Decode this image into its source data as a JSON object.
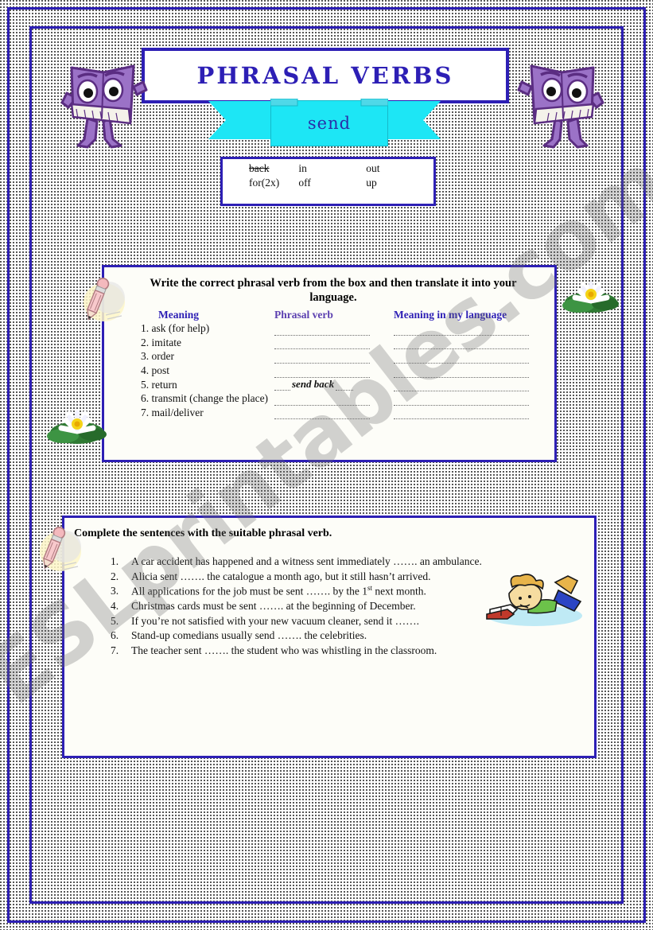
{
  "page": {
    "title": "PHRASAL VERBS",
    "verb": "send",
    "watermark": "ESLprintables.com",
    "border_color": "#2d1fb5",
    "accent_color": "#1de6f5"
  },
  "word_bank": {
    "rows": [
      {
        "c1": "back",
        "c1_struck": true,
        "c2": "in",
        "c3": "out"
      },
      {
        "c1": "for(2x)",
        "c1_struck": false,
        "c2": "off",
        "c3": "up"
      }
    ]
  },
  "exercise1": {
    "instruction": "Write the correct phrasal verb from the box and then translate it into your language.",
    "headers": {
      "meaning": "Meaning",
      "phrasal_verb": "Phrasal verb",
      "translation": "Meaning in my language"
    },
    "rows": [
      {
        "num": "1.",
        "meaning": "ask (for help)",
        "answer": ""
      },
      {
        "num": "2.",
        "meaning": "imitate",
        "answer": ""
      },
      {
        "num": "3.",
        "meaning": "order",
        "answer": ""
      },
      {
        "num": "4.",
        "meaning": "post",
        "answer": ""
      },
      {
        "num": "5.",
        "meaning": "return",
        "answer": "send back"
      },
      {
        "num": "6.",
        "meaning": "transmit (change the place)",
        "answer": ""
      },
      {
        "num": "7.",
        "meaning": "mail/deliver",
        "answer": ""
      }
    ]
  },
  "exercise2": {
    "instruction": "Complete the sentences with the suitable phrasal verb.",
    "sentences": [
      {
        "num": "1.",
        "before": "A car accident has happened and a witness sent immediately ……. an ambulance.",
        "sup": "",
        "after": ""
      },
      {
        "num": "2.",
        "before": "Alicia sent ……. the catalogue a month ago, but it still hasn’t arrived.",
        "sup": "",
        "after": ""
      },
      {
        "num": "3.",
        "before": "All applications for the job must be sent ……. by the 1",
        "sup": "st",
        "after": " next month."
      },
      {
        "num": "4.",
        "before": "Christmas cards must be sent ……. at the beginning of December.",
        "sup": "",
        "after": ""
      },
      {
        "num": "5.",
        "before": "If you’re not satisfied with your new vacuum cleaner, send it …….",
        "sup": "",
        "after": ""
      },
      {
        "num": "6.",
        "before": "Stand-up comedians usually send ……. the celebrities.",
        "sup": "",
        "after": ""
      },
      {
        "num": "7.",
        "before": "The teacher sent ……. the student who was whistling in the classroom.",
        "sup": "",
        "after": ""
      }
    ]
  },
  "decorations": {
    "book_left": "book-character-icon",
    "book_right": "book-character-icon",
    "lily_right": "water-lily-icon",
    "lily_left": "water-lily-icon",
    "pencil_1": "pencil-icon",
    "pencil_2": "pencil-icon",
    "kid_reading": "child-reading-icon"
  }
}
